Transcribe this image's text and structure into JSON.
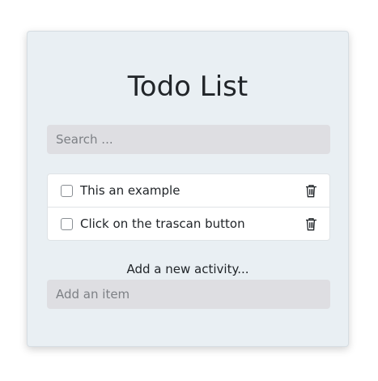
{
  "app": {
    "title": "Todo List"
  },
  "search": {
    "placeholder": "Search ...",
    "value": ""
  },
  "todos": [
    {
      "label": "This an example",
      "checked": false,
      "delete_icon": "trash-icon"
    },
    {
      "label": "Click on the trascan button",
      "checked": false,
      "delete_icon": "trash-icon"
    }
  ],
  "add": {
    "label": "Add a new activity...",
    "placeholder": "Add an item",
    "value": ""
  }
}
